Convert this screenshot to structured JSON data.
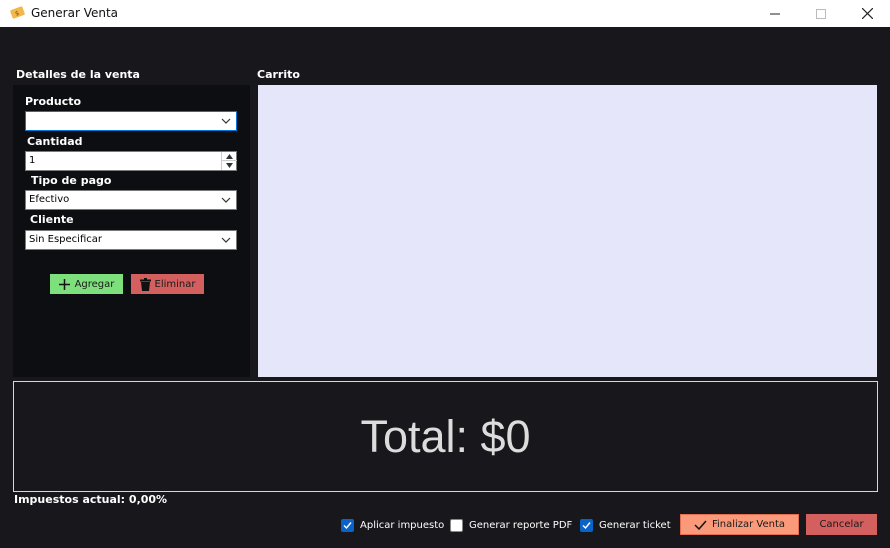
{
  "window": {
    "title": "Generar Venta",
    "icons": [
      "app-ticket-icon",
      "minimize-icon",
      "maximize-icon",
      "close-icon"
    ]
  },
  "details": {
    "section_label": "Detalles de la venta",
    "producto_label": "Producto",
    "producto_value": "",
    "cantidad_label": "Cantidad",
    "cantidad_value": "1",
    "tipo_pago_label": "Tipo de pago",
    "tipo_pago_value": "Efectivo",
    "cliente_label": "Cliente",
    "cliente_value": "Sin Especificar",
    "add_label": "Agregar",
    "delete_label": "Eliminar"
  },
  "cart": {
    "section_label": "Carrito"
  },
  "summary": {
    "total_text": "Total: $0",
    "tax_text": "Impuestos actual: 0,00%"
  },
  "options": {
    "aplicar_impuesto": {
      "label": "Aplicar impuesto",
      "checked": true
    },
    "generar_pdf": {
      "label": "Generar reporte PDF",
      "checked": false
    },
    "generar_ticket": {
      "label": "Generar ticket",
      "checked": true
    }
  },
  "actions": {
    "finalizar_label": "Finalizar Venta",
    "cancelar_label": "Cancelar"
  },
  "colors": {
    "background": "#17171c",
    "panel": "#0d0e12",
    "cart": "#e6e6fa",
    "add_button": "#7de07d",
    "delete_button": "#d45f5f",
    "finalize_button": "#fa9a7a",
    "checkbox_accent": "#0a64c8"
  }
}
